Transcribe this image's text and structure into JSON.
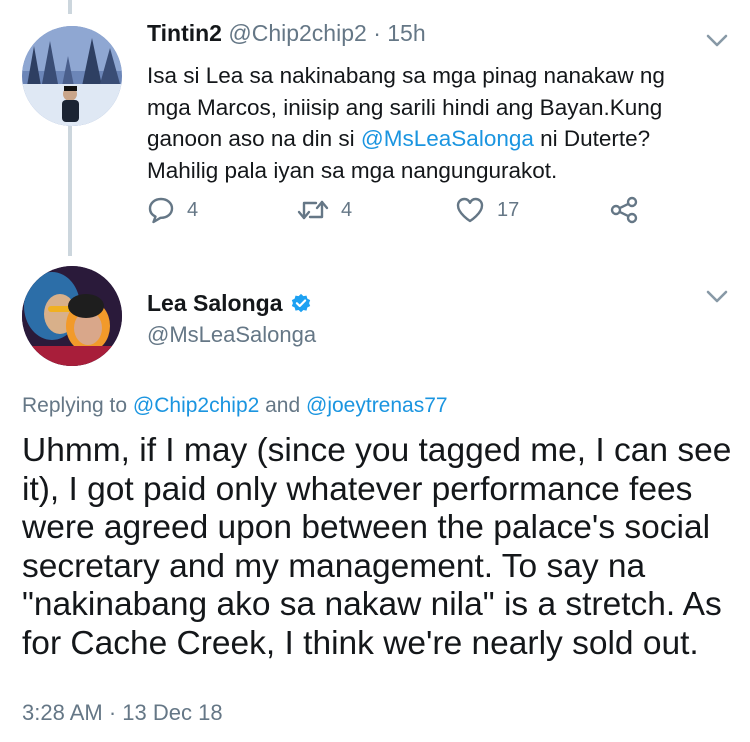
{
  "tweet1": {
    "name": "Tintin2",
    "handle": "@Chip2chip2",
    "separator": "·",
    "time": "15h",
    "text_before": "Isa si Lea sa nakinabang sa mga pinag nanakaw ng mga Marcos, iniisip ang sarili hindi ang Bayan.Kung ganoon aso na din si ",
    "mention": "@MsLeaSalonga",
    "text_after": " ni Duterte? Mahilig pala iyan sa mga nangungurakot.",
    "replies": "4",
    "retweets": "4",
    "likes": "17"
  },
  "tweet2": {
    "name": "Lea Salonga",
    "handle": "@MsLeaSalonga",
    "replying_prefix": "Replying to ",
    "replying_to_1": "@Chip2chip2",
    "replying_and": " and ",
    "replying_to_2": "@joeytrenas77",
    "text": "Uhmm, if I may (since you tagged me, I can see it), I got paid only whatever performance fees were agreed upon between the palace's social secretary and my management. To say na \"nakinabang ako sa nakaw nila\" is a stretch. As for Cache Creek, I think we're nearly sold out.",
    "timestamp": "3:28 AM · 13 Dec 18"
  },
  "colors": {
    "text": "#14171a",
    "secondary": "#657786",
    "link": "#1b95e0",
    "verified": "#1da1f2",
    "thread_line": "#ccd6dd"
  },
  "icons": [
    "reply-icon",
    "retweet-icon",
    "like-icon",
    "share-icon",
    "chevron-down-icon",
    "verified-badge-icon"
  ]
}
